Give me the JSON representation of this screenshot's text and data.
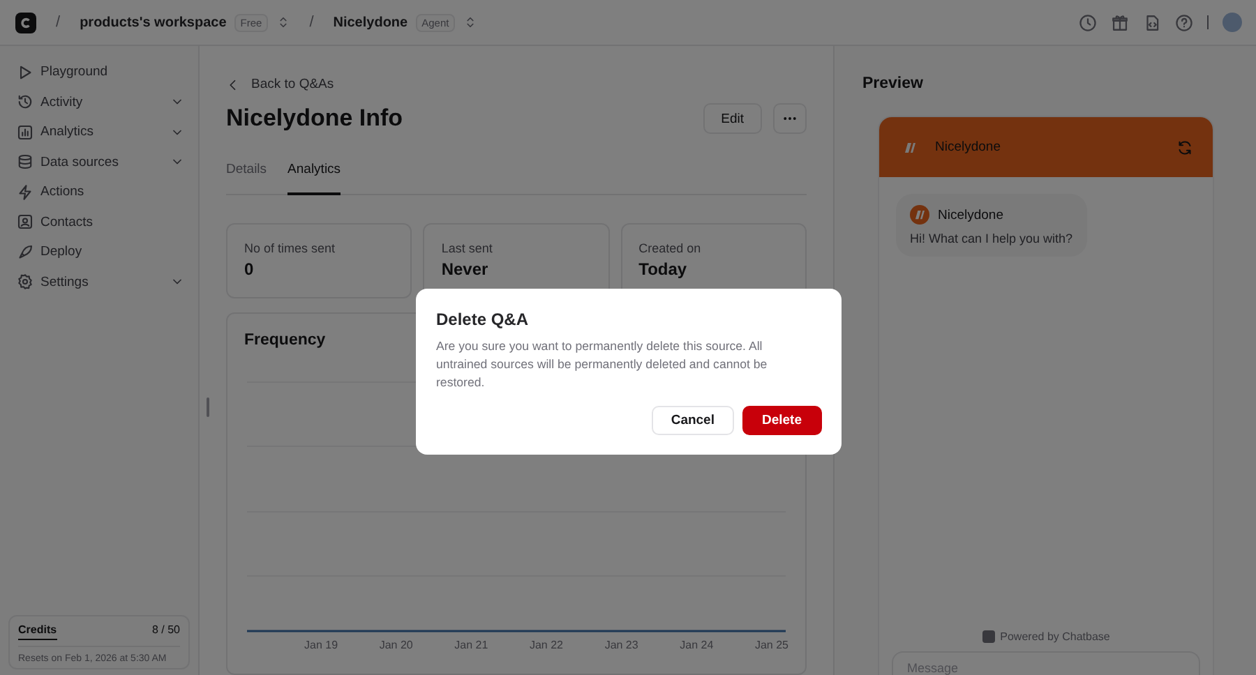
{
  "topbar": {
    "separators": [
      "/",
      "/"
    ],
    "workspace": "products's workspace",
    "workspace_badge": "Free",
    "agent": "Nicelydone",
    "agent_badge": "Agent"
  },
  "sidebar": {
    "items": [
      {
        "label": "Playground",
        "has_submenu": false
      },
      {
        "label": "Activity",
        "has_submenu": true
      },
      {
        "label": "Analytics",
        "has_submenu": true
      },
      {
        "label": "Data sources",
        "has_submenu": true
      },
      {
        "label": "Actions",
        "has_submenu": false
      },
      {
        "label": "Contacts",
        "has_submenu": false
      },
      {
        "label": "Deploy",
        "has_submenu": false
      },
      {
        "label": "Settings",
        "has_submenu": true
      }
    ],
    "credits": {
      "label": "Credits",
      "value": "8 / 50",
      "resets": "Resets on Feb 1, 2026 at 5:30 AM"
    }
  },
  "main": {
    "back_link": "Back to Q&As",
    "title": "Nicelydone Info",
    "edit_button": "Edit",
    "tabs": [
      {
        "label": "Details",
        "selected": false
      },
      {
        "label": "Analytics",
        "selected": true
      }
    ],
    "stats": [
      {
        "label": "No of times sent",
        "value": "0"
      },
      {
        "label": "Last sent",
        "value": "Never"
      },
      {
        "label": "Created on",
        "value": "Today"
      }
    ],
    "chart": {
      "title": "Frequency",
      "x_labels": [
        "Jan 19",
        "Jan 20",
        "Jan 21",
        "Jan 22",
        "Jan 23",
        "Jan 24",
        "Jan 25"
      ]
    }
  },
  "preview": {
    "title": "Preview",
    "header_name": "Nicelydone",
    "message": {
      "sender": "Nicelydone",
      "text": "Hi! What can I help you with?"
    },
    "powered_by": "Powered by Chatbase",
    "input_placeholder": "Message"
  },
  "dialog": {
    "title": "Delete Q&A",
    "body": "Are you sure you want to permanently delete this source. All untrained sources will be permanently deleted and cannot be restored.",
    "buttons": [
      {
        "label": "Cancel",
        "kind": "secondary"
      },
      {
        "label": "Delete",
        "kind": "danger"
      }
    ]
  }
}
